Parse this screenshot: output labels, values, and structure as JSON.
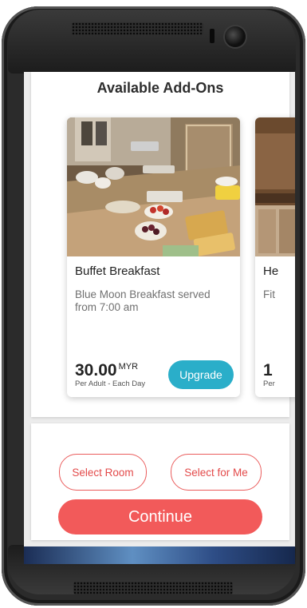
{
  "page": {
    "title": "Available Add-Ons"
  },
  "addons": [
    {
      "title": "Buffet Breakfast",
      "description_lines": [
        "Blue Moon Breakfast served",
        "from 7:00 am"
      ],
      "price": "30.00",
      "currency": "MYR",
      "price_note": "Per Adult - Each Day",
      "button_label": "Upgrade"
    },
    {
      "title": "He",
      "description": "Fit",
      "price": "1",
      "price_note": "Per"
    }
  ],
  "actions": {
    "select_room_label": "Select Room",
    "select_for_me_label": "Select for Me",
    "continue_label": "Continue"
  },
  "colors": {
    "accent": "#f25a5a",
    "upgrade": "#2aaec9",
    "outline": "#ea5c5c"
  }
}
